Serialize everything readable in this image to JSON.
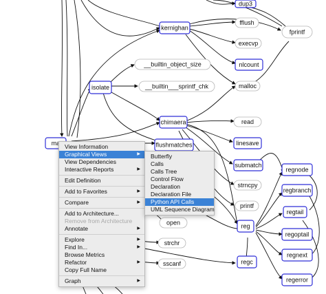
{
  "graph": {
    "nodes": [
      {
        "id": "n_dup3",
        "label": "dup3",
        "box": true
      },
      {
        "id": "n_kernighan",
        "label": "kernighan",
        "box": true
      },
      {
        "id": "n_fflush",
        "label": "fflush",
        "box": false
      },
      {
        "id": "n_fprintf",
        "label": "fprintf",
        "box": false
      },
      {
        "id": "n_execvp",
        "label": "execvp",
        "box": false
      },
      {
        "id": "n_bos",
        "label": "__builtin_object_size",
        "box": false
      },
      {
        "id": "n_nlcount",
        "label": "nlcount",
        "box": true
      },
      {
        "id": "n_isolate",
        "label": "isolate",
        "box": true
      },
      {
        "id": "n_bsp",
        "label": "__builtin___sprintf_chk",
        "box": false
      },
      {
        "id": "n_malloc",
        "label": "malloc",
        "box": false
      },
      {
        "id": "n_chimaera",
        "label": "chimaera",
        "box": true
      },
      {
        "id": "n_read",
        "label": "read",
        "box": false
      },
      {
        "id": "n_main",
        "label": "ma",
        "box": true
      },
      {
        "id": "n_flushmatches",
        "label": "flushmatches",
        "box": true
      },
      {
        "id": "n_linesave",
        "label": "linesave",
        "box": true
      },
      {
        "id": "n_submatch",
        "label": "submatch",
        "box": true
      },
      {
        "id": "n_regnode",
        "label": "regnode",
        "box": true
      },
      {
        "id": "n_regbranch",
        "label": "regbranch",
        "box": true
      },
      {
        "id": "n_strncpy",
        "label": "strncpy",
        "box": false
      },
      {
        "id": "n_regtail",
        "label": "regtail",
        "box": true
      },
      {
        "id": "n_printf",
        "label": "printf",
        "box": false
      },
      {
        "id": "n_open",
        "label": "open",
        "box": false
      },
      {
        "id": "n_reg",
        "label": "reg",
        "box": true
      },
      {
        "id": "n_regoptail",
        "label": "regoptail",
        "box": true
      },
      {
        "id": "n_strchr",
        "label": "strchr",
        "box": false
      },
      {
        "id": "n_regnext",
        "label": "regnext",
        "box": true
      },
      {
        "id": "n_sscanf",
        "label": "sscanf",
        "box": false
      },
      {
        "id": "n_regc",
        "label": "regc",
        "box": true
      },
      {
        "id": "n_regerror",
        "label": "regerror",
        "box": true
      }
    ]
  },
  "context_menu": {
    "items": [
      {
        "label": "View Information"
      },
      {
        "label": "Graphical Views",
        "submenu": true,
        "highlighted": true
      },
      {
        "label": "View Dependencies"
      },
      {
        "label": "Interactive Reports",
        "submenu": true
      },
      {
        "separator": true
      },
      {
        "label": "Edit Definition"
      },
      {
        "separator": true
      },
      {
        "label": "Add to Favorites",
        "submenu": true
      },
      {
        "separator": true
      },
      {
        "label": "Compare",
        "submenu": true
      },
      {
        "separator": true
      },
      {
        "label": "Add to Architecture..."
      },
      {
        "label": "Remove from Architecture",
        "disabled": true
      },
      {
        "label": "Annotate",
        "submenu": true
      },
      {
        "separator": true
      },
      {
        "label": "Explore",
        "submenu": true
      },
      {
        "label": "Find In...",
        "submenu": true
      },
      {
        "label": "Browse Metrics"
      },
      {
        "label": "Refactor",
        "submenu": true
      },
      {
        "label": "Copy Full Name"
      },
      {
        "separator": true
      },
      {
        "label": "Graph",
        "submenu": true
      }
    ]
  },
  "submenu": {
    "items": [
      {
        "label": "Butterfly"
      },
      {
        "label": "Calls"
      },
      {
        "label": "Calls Tree"
      },
      {
        "label": "Control Flow"
      },
      {
        "label": "Declaration"
      },
      {
        "label": "Declaration File"
      },
      {
        "label": "Python API Calls",
        "highlighted": true
      },
      {
        "label": "UML Sequence Diagram"
      }
    ]
  },
  "colors": {
    "node_border": "#2f2fd8",
    "edge": "#111111",
    "highlight": "#3b82d6",
    "menu_bg": "#ececec"
  }
}
